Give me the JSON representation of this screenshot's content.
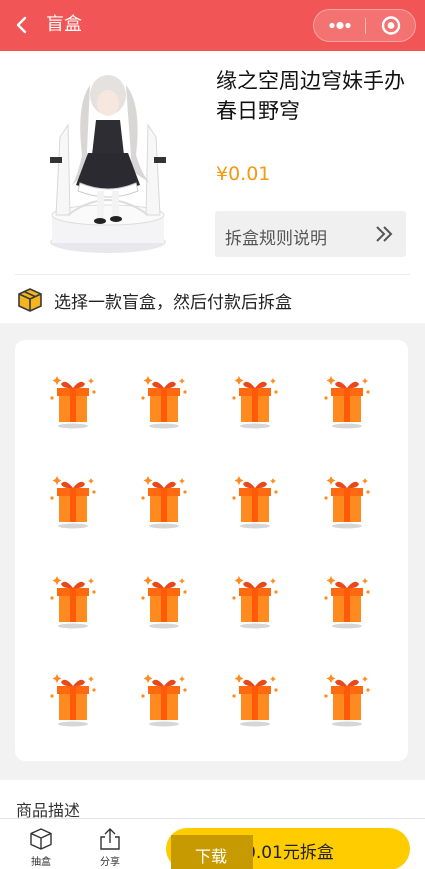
{
  "navbar": {
    "title": "盲盒"
  },
  "product": {
    "name": "缘之空周边穹妹手办春日野穹",
    "price": "¥0.01",
    "rules_label": "拆盒规则说明"
  },
  "hint": {
    "text": "选择一款盲盒，然后付款后拆盒"
  },
  "boxes": {
    "count": 16
  },
  "description": {
    "title": "商品描述"
  },
  "bottombar": {
    "tabs": [
      {
        "label": "抽盒",
        "icon": "box-icon"
      },
      {
        "label": "分享",
        "icon": "share-icon"
      }
    ],
    "buy_label": "0.01元拆盒",
    "download_label": "下载"
  },
  "colors": {
    "navbar": "#f15555",
    "price": "#f39a12",
    "buy_button": "#ffcc00",
    "download": "#c69a00",
    "box_orange": "#ff8a1f"
  }
}
